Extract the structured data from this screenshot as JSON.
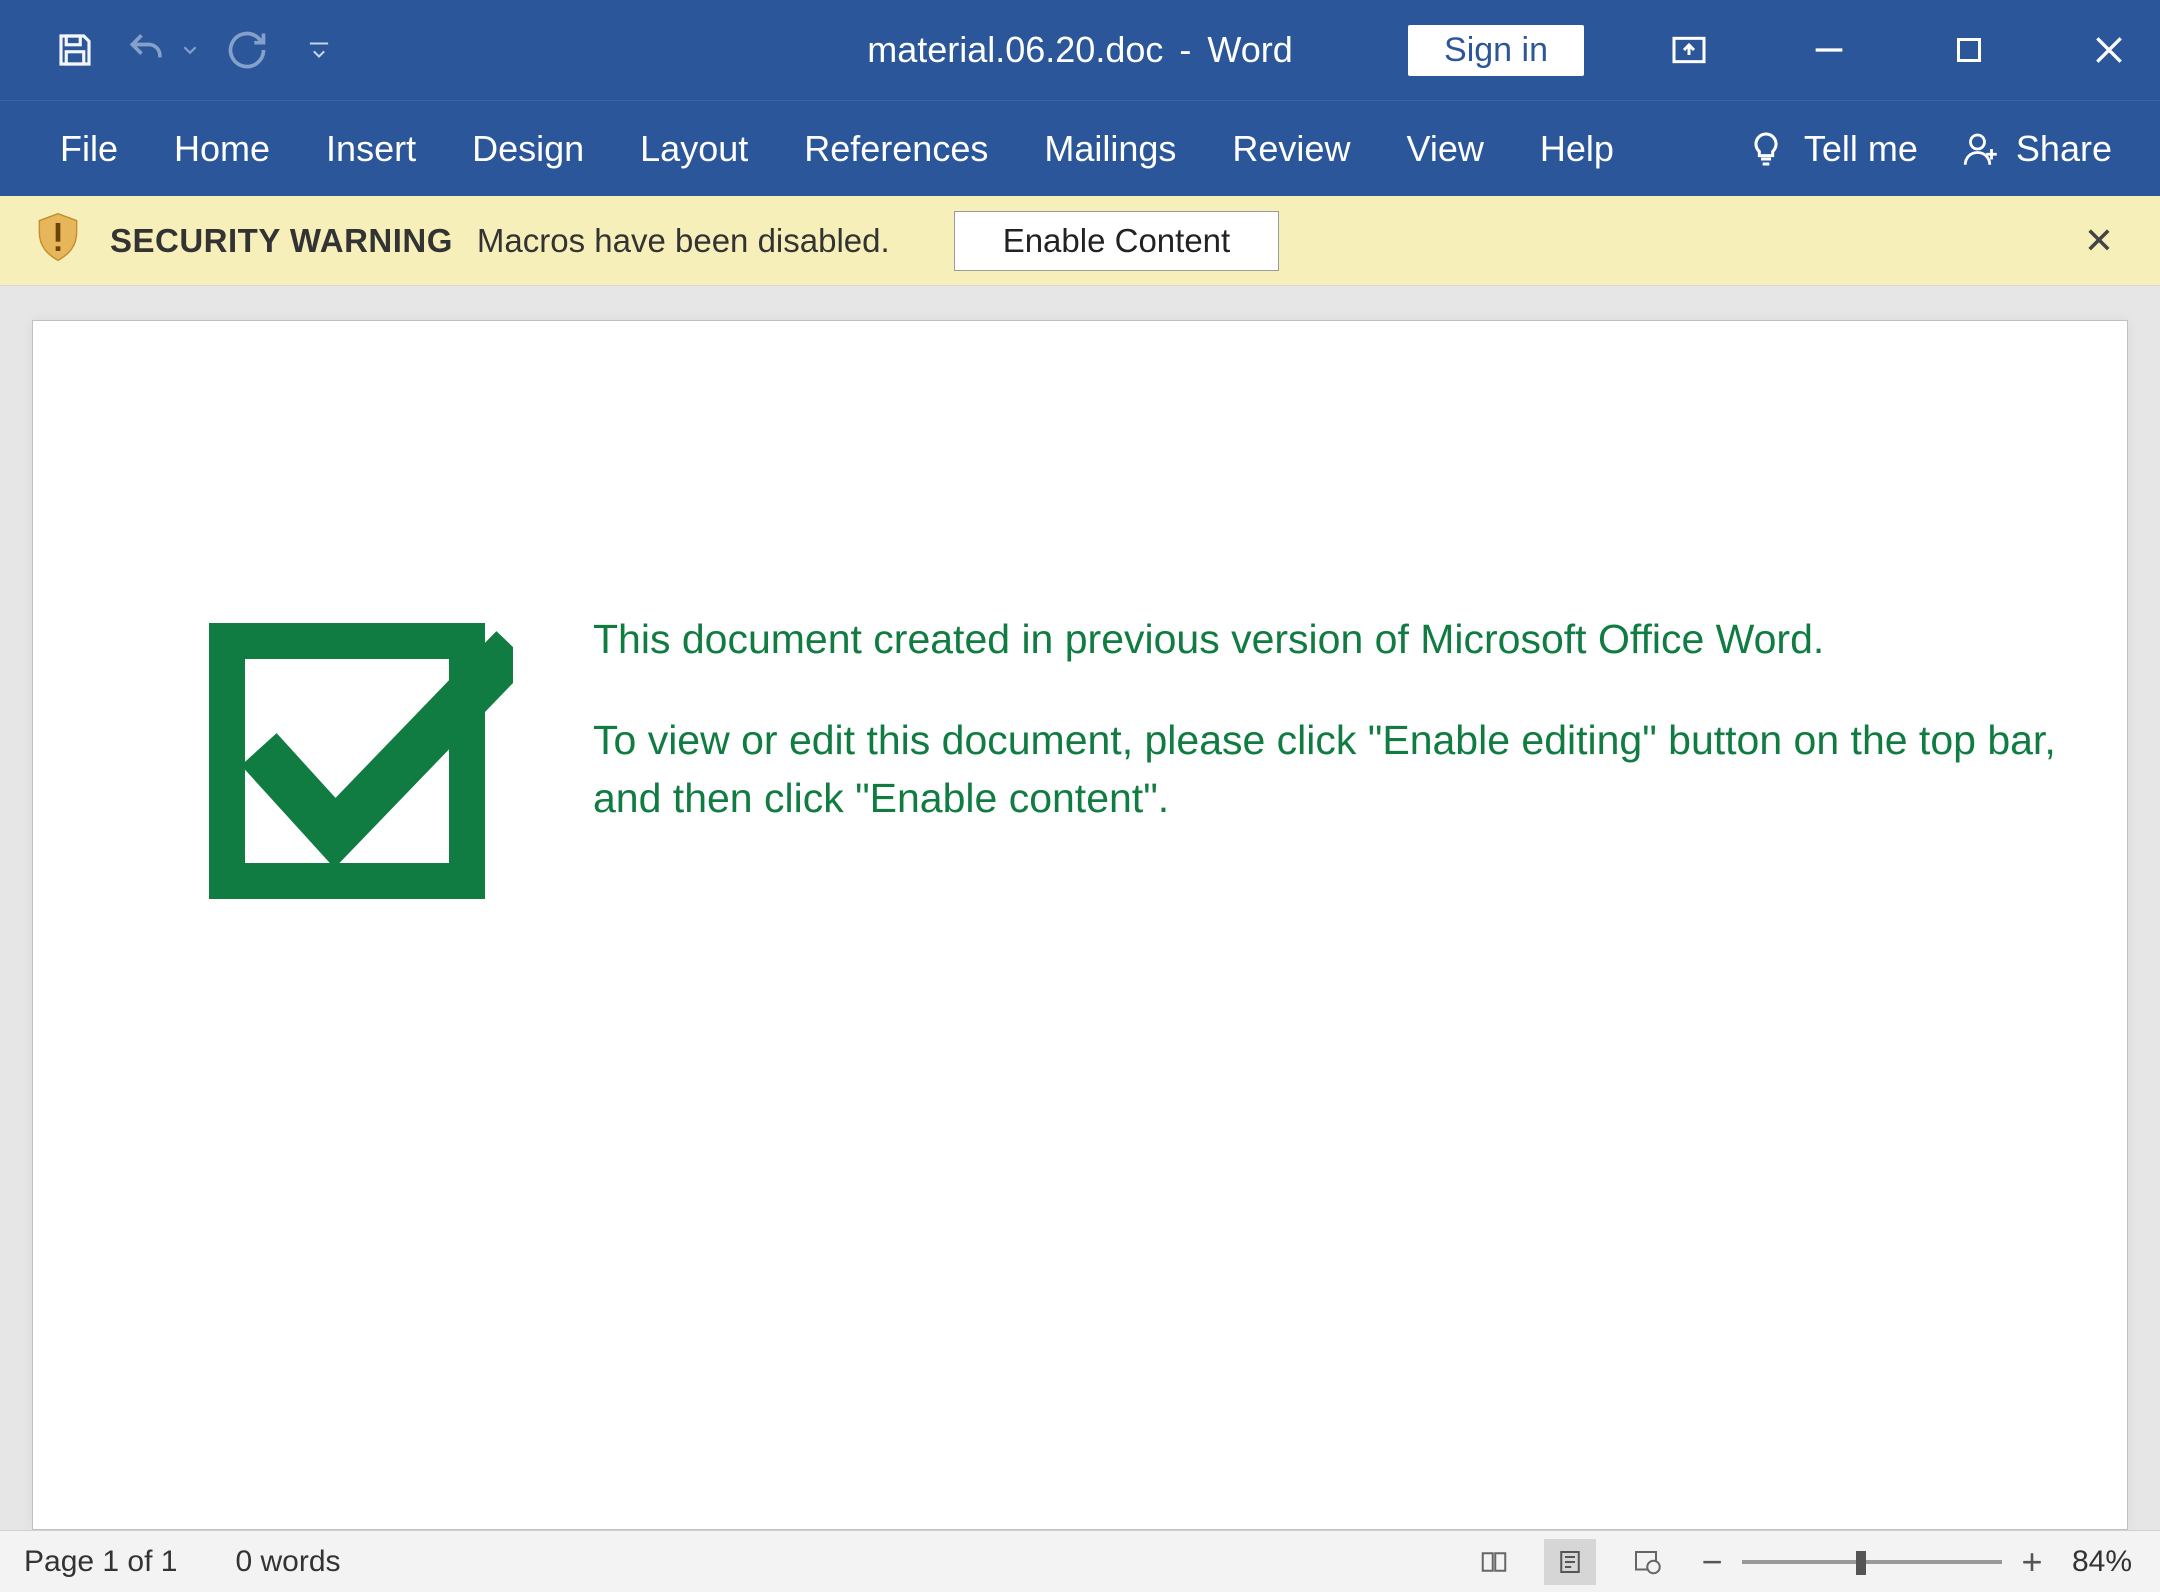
{
  "titlebar": {
    "filename": "material.06.20.doc",
    "separator": "-",
    "appname": "Word",
    "signin": "Sign in"
  },
  "ribbon": {
    "tabs": [
      "File",
      "Home",
      "Insert",
      "Design",
      "Layout",
      "References",
      "Mailings",
      "Review",
      "View",
      "Help"
    ],
    "tellme": "Tell me",
    "share": "Share"
  },
  "warning": {
    "title": "SECURITY WARNING",
    "message": "Macros have been disabled.",
    "button": "Enable Content"
  },
  "document": {
    "line1": "This document created in previous version of Microsoft Office Word.",
    "line2": "To view or edit this document, please click \"Enable editing\" button on the top bar, and then click \"Enable content\"."
  },
  "status": {
    "page": "Page 1 of 1",
    "words": "0 words",
    "zoom": "84%"
  }
}
